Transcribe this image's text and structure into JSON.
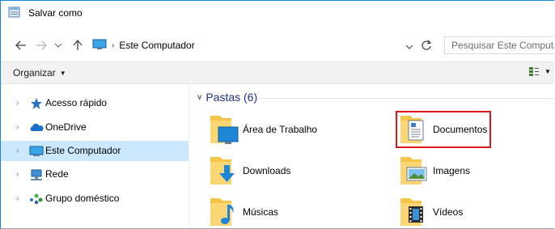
{
  "window": {
    "title": "Salvar como"
  },
  "address": {
    "crumb": "Este Computador",
    "search_placeholder": "Pesquisar Este Computador"
  },
  "toolbar": {
    "organize_label": "Organizar"
  },
  "nav": {
    "items": [
      {
        "label": "Acesso rápido",
        "icon": "star-icon"
      },
      {
        "label": "OneDrive",
        "icon": "cloud-icon"
      },
      {
        "label": "Este Computador",
        "icon": "computer-icon",
        "selected": true
      },
      {
        "label": "Rede",
        "icon": "network-icon"
      },
      {
        "label": "Grupo doméstico",
        "icon": "homegroup-icon"
      }
    ]
  },
  "content": {
    "group_title": "Pastas (6)",
    "folders": [
      {
        "label": "Área de Trabalho",
        "icon": "desktop-folder-icon"
      },
      {
        "label": "Documentos",
        "icon": "documents-folder-icon",
        "highlighted": true
      },
      {
        "label": "Downloads",
        "icon": "downloads-folder-icon"
      },
      {
        "label": "Imagens",
        "icon": "pictures-folder-icon"
      },
      {
        "label": "Músicas",
        "icon": "music-folder-icon"
      },
      {
        "label": "Vídeos",
        "icon": "videos-folder-icon"
      }
    ]
  },
  "colors": {
    "accent": "#1883d7",
    "selection": "#cce8ff",
    "highlight": "#e0161a",
    "group_header": "#1e3287"
  }
}
